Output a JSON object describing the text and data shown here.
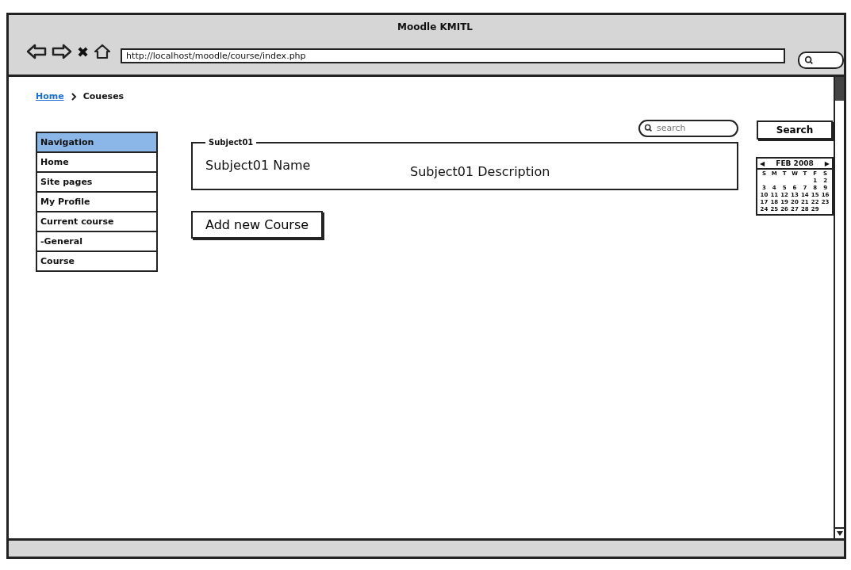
{
  "window": {
    "title": "Moodle KMITL"
  },
  "toolbar": {
    "stop": "✖",
    "url": "http://localhost/moodle/course/index.php"
  },
  "breadcrumb": [
    {
      "label": "Home",
      "kind": "link"
    },
    {
      "label": "Coueses",
      "kind": "current"
    }
  ],
  "navigation": {
    "items": [
      {
        "label": "Navigation",
        "selected": true
      },
      {
        "label": "Home",
        "selected": false
      },
      {
        "label": "Site pages",
        "selected": false
      },
      {
        "label": "My Profile",
        "selected": false
      },
      {
        "label": "Current course",
        "selected": false
      },
      {
        "label": "-General",
        "selected": false
      },
      {
        "label": "Course",
        "selected": false
      }
    ]
  },
  "search": {
    "placeholder": "search",
    "button": "Search"
  },
  "subject": {
    "legend": "Subject01",
    "name": "Subject01 Name",
    "description": "Subject01  Description"
  },
  "add_button": "Add new Course",
  "calendar": {
    "prev": "◀",
    "month": "FEB 2008",
    "next": "▶",
    "weekdays": [
      "S",
      "M",
      "T",
      "W",
      "T",
      "F",
      "S"
    ],
    "weeks": [
      [
        "1",
        "2"
      ],
      [
        "3",
        "4",
        "5",
        "6",
        "7",
        "8",
        "9"
      ],
      [
        "10",
        "11",
        "12",
        "13",
        "14",
        "15",
        "16"
      ],
      [
        "17",
        "18",
        "19",
        "20",
        "21",
        "22",
        "23"
      ],
      [
        "24",
        "25",
        "26",
        "27",
        "28",
        "29"
      ]
    ]
  }
}
